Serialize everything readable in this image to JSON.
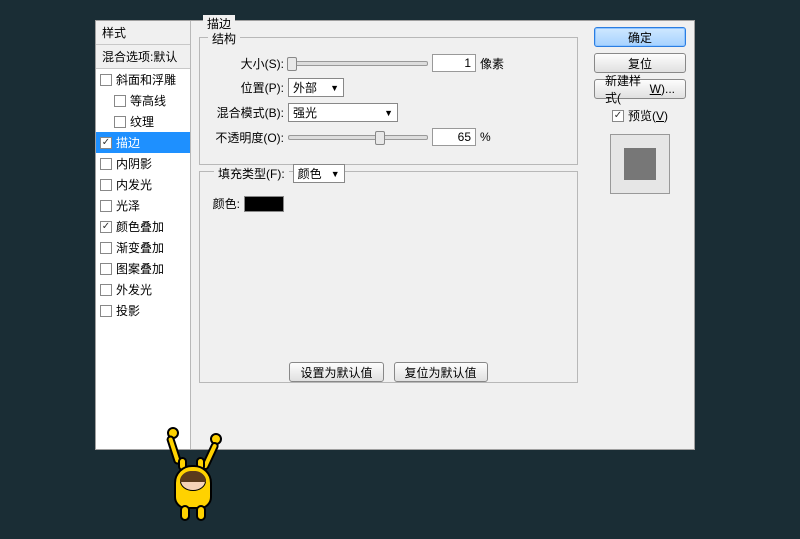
{
  "sidebar": {
    "header": "样式",
    "blend": "混合选项:默认",
    "items": [
      {
        "label": "斜面和浮雕",
        "checked": false,
        "indent": false,
        "selected": false
      },
      {
        "label": "等高线",
        "checked": false,
        "indent": true,
        "selected": false
      },
      {
        "label": "纹理",
        "checked": false,
        "indent": true,
        "selected": false
      },
      {
        "label": "描边",
        "checked": true,
        "indent": false,
        "selected": true
      },
      {
        "label": "内阴影",
        "checked": false,
        "indent": false,
        "selected": false
      },
      {
        "label": "内发光",
        "checked": false,
        "indent": false,
        "selected": false
      },
      {
        "label": "光泽",
        "checked": false,
        "indent": false,
        "selected": false
      },
      {
        "label": "颜色叠加",
        "checked": true,
        "indent": false,
        "selected": false
      },
      {
        "label": "渐变叠加",
        "checked": false,
        "indent": false,
        "selected": false
      },
      {
        "label": "图案叠加",
        "checked": false,
        "indent": false,
        "selected": false
      },
      {
        "label": "外发光",
        "checked": false,
        "indent": false,
        "selected": false
      },
      {
        "label": "投影",
        "checked": false,
        "indent": false,
        "selected": false
      }
    ]
  },
  "main": {
    "title": "描边",
    "structure": {
      "legend": "结构",
      "size_label": "大小(S):",
      "size_value": "1",
      "size_unit": "像素",
      "position_label": "位置(P):",
      "position_value": "外部",
      "blendmode_label": "混合模式(B):",
      "blendmode_value": "强光",
      "opacity_label": "不透明度(O):",
      "opacity_value": "65",
      "opacity_unit": "%"
    },
    "fill": {
      "filltype_label": "填充类型(F):",
      "filltype_value": "颜色",
      "color_label": "颜色:",
      "color_value": "#000000"
    },
    "buttons": {
      "set_default": "设置为默认值",
      "reset_default": "复位为默认值"
    }
  },
  "right": {
    "ok": "确定",
    "reset": "复位",
    "new_style_prefix": "新建样式(",
    "new_style_key": "W",
    "new_style_suffix": ")...",
    "preview_prefix": "预览(",
    "preview_key": "V",
    "preview_suffix": ")",
    "preview_checked": true
  }
}
